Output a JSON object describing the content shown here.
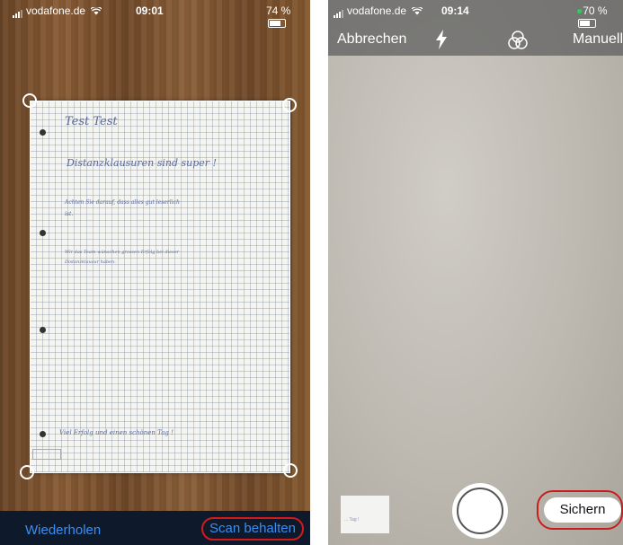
{
  "left_screen": {
    "status": {
      "carrier": "vodafone.de",
      "time": "09:01",
      "battery": "74 %",
      "battery_fill": 0.74
    },
    "document": {
      "lines": [
        "Test      Test",
        "Distanzklausuren  sind  super  !",
        "Achten  Sie  darauf,  dass  alles  gut  leserlich",
        "ist.",
        "Wir  das  Team  wünschen  grossen  Erfolg  bei  dieser",
        "Distanzklausur  haben.",
        "Viel  Erfolg  und  einen  schönen  Tag !"
      ]
    },
    "toolbar": {
      "retake_label": "Wiederholen",
      "keep_label": "Scan behalten"
    }
  },
  "right_screen": {
    "status": {
      "carrier": "vodafone.de",
      "time": "09:14",
      "battery": "70 %",
      "battery_fill": 0.7
    },
    "topbar": {
      "cancel_label": "Abbrechen",
      "manual_label": "Manuell"
    },
    "thumbnail_text": "... Tag !",
    "save_label": "Sichern"
  },
  "colors": {
    "accent_blue": "#3a8ef0",
    "highlight_red": "#d21a1a",
    "bottom_bar": "#0e1a2c",
    "battery_green": "#34c759"
  }
}
